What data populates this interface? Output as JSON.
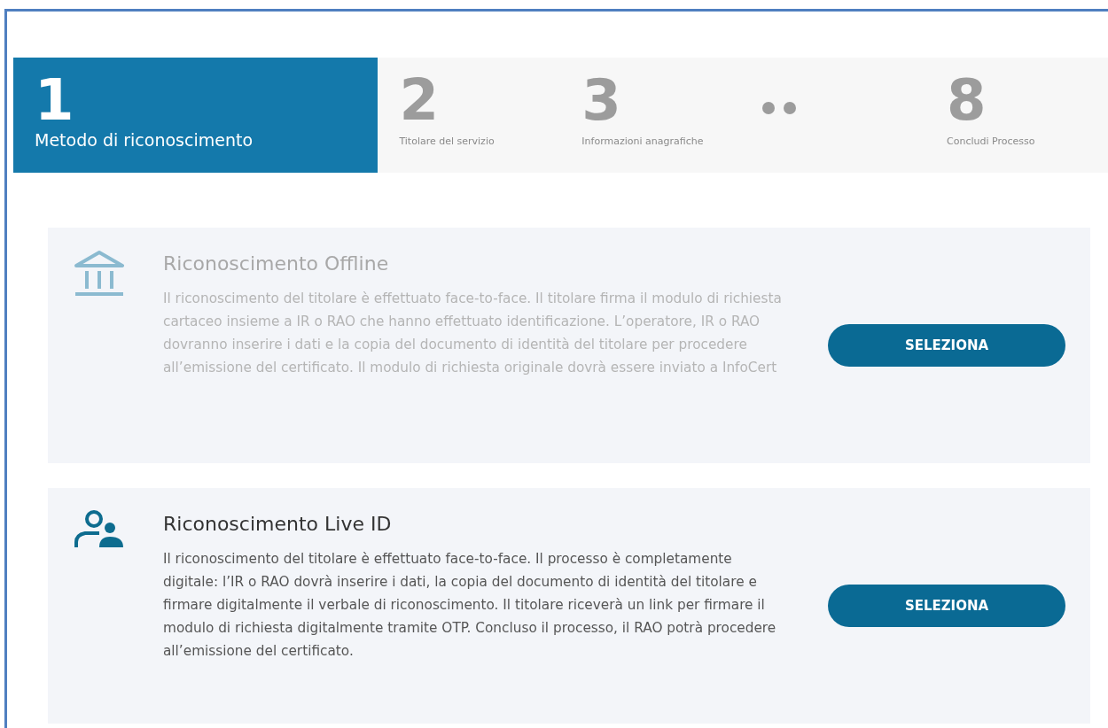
{
  "steps": [
    {
      "kind": "step",
      "number": "1",
      "label": "Metodo di riconoscimento",
      "selected": true
    },
    {
      "kind": "step",
      "number": "2",
      "label": "Titolare del servizio",
      "selected": false
    },
    {
      "kind": "step",
      "number": "3",
      "label": "Informazioni anagrafiche",
      "selected": false
    },
    {
      "kind": "ellipsis"
    },
    {
      "kind": "step",
      "number": "8",
      "label": "Concludi Processo",
      "selected": false
    }
  ],
  "options": [
    {
      "kind": "offline",
      "title": "Riconoscimento Offline",
      "disabled": true,
      "description": "Il riconoscimento del titolare è effettuato face-to-face. Il titolare firma il modulo di richiesta cartaceo insieme a IR o RAO che hanno effettuato identificazione. L’operatore, IR o RAO dovranno inserire i dati e la copia del documento di identità del titolare per procedere all’emissione del certificato. Il modulo di richiesta originale dovrà essere inviato a InfoCert",
      "button": "SELEZIONA"
    },
    {
      "kind": "live",
      "title": "Riconoscimento Live ID",
      "disabled": false,
      "description": "Il riconoscimento del titolare è effettuato face-to-face. Il processo è completamente digitale: l’IR o RAO dovrà inserire i dati, la copia del documento di identità del titolare e firmare digitalmente il verbale di riconoscimento. Il titolare riceverà un link per firmare il modulo di richiesta digitalmente tramite OTP. Concluso il processo, il RAO potrà procedere all’emissione del certificato.",
      "button": "SELEZIONA"
    }
  ]
}
